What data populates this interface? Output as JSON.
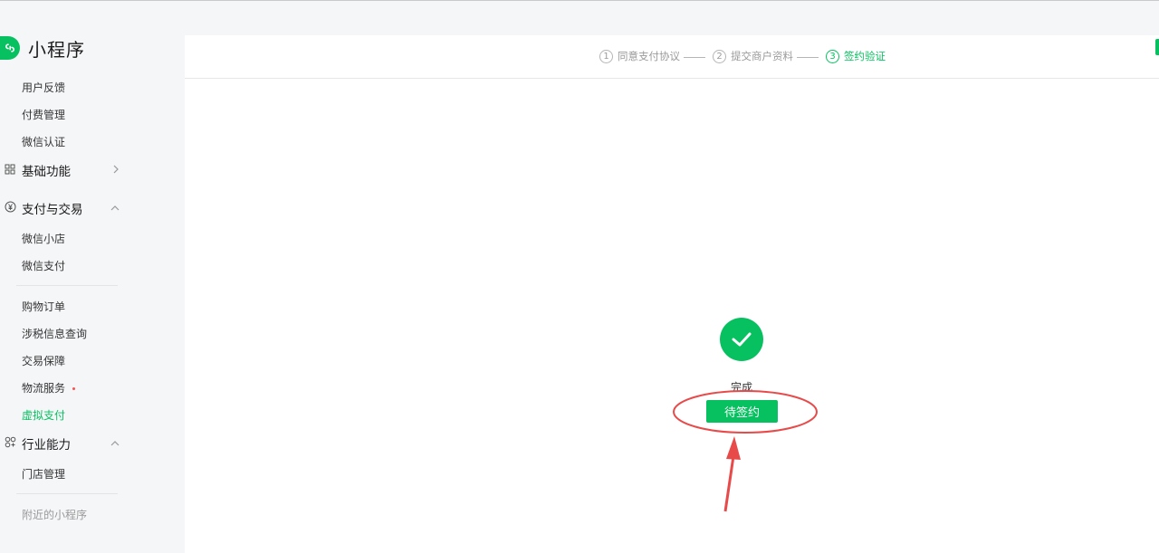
{
  "brand": {
    "title": "小程序",
    "icon": "mini-program-logo"
  },
  "sidebar": {
    "items_top": [
      "用户反馈",
      "付费管理",
      "微信认证"
    ],
    "groups": {
      "basic": {
        "label": "基础功能",
        "icon": "grid-icon",
        "state": "collapsed"
      },
      "payment": {
        "label": "支付与交易",
        "icon": "yen-circle-icon",
        "state": "expanded"
      },
      "industry": {
        "label": "行业能力",
        "icon": "nodes-icon",
        "state": "expanded"
      }
    },
    "payment_items": [
      "微信小店",
      "微信支付",
      "购物订单",
      "涉税信息查询",
      "交易保障",
      "物流服务",
      "虚拟支付"
    ],
    "active_item": "虚拟支付",
    "industry_items": [
      "门店管理"
    ],
    "footer_item": "附近的小程序"
  },
  "steps": [
    {
      "num": "1",
      "label": "同意支付协议"
    },
    {
      "num": "2",
      "label": "提交商户资料"
    },
    {
      "num": "3",
      "label": "签约验证"
    }
  ],
  "current_step": 3,
  "result": {
    "status": "完成",
    "button": "待签约"
  },
  "colors": {
    "accent": "#07c160",
    "annotation": "#e84a4a",
    "badge": "#fa5151"
  }
}
